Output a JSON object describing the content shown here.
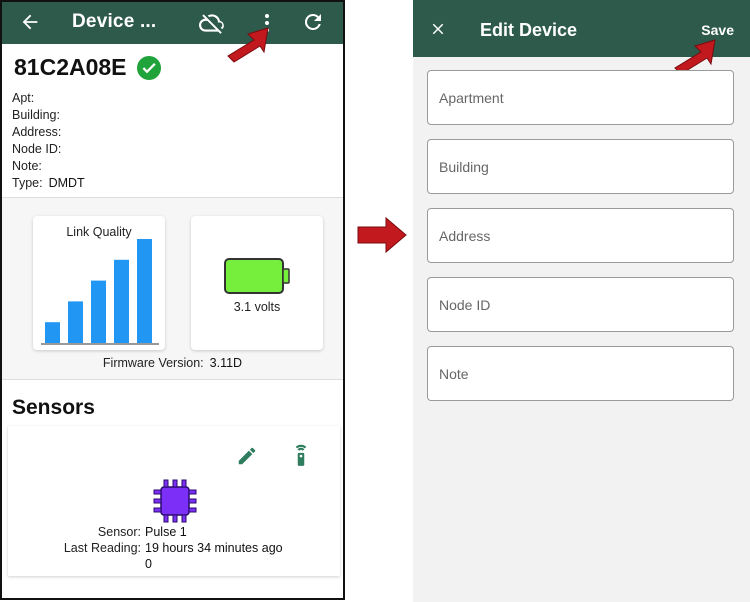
{
  "left_screen": {
    "appbar": {
      "title": "Device ...",
      "icons": [
        "arrow-back-icon",
        "cloud-off-icon",
        "more-vert-icon",
        "refresh-icon"
      ]
    },
    "device_id": "81C2A08E",
    "properties": [
      {
        "label": "Apt:",
        "value": ""
      },
      {
        "label": "Building:",
        "value": ""
      },
      {
        "label": "Address:",
        "value": ""
      },
      {
        "label": "Node ID:",
        "value": ""
      },
      {
        "label": "Note:",
        "value": ""
      },
      {
        "label": "Type:",
        "value": "DMDT"
      }
    ],
    "link_quality": {
      "title": "Link Quality",
      "bar_levels": [
        0.2,
        0.4,
        0.6,
        0.8,
        1.0
      ],
      "bar_color": "#2196f3"
    },
    "battery": {
      "label": "3.1 volts",
      "fill_color": "#76ee3c"
    },
    "firmware": {
      "label": "Firmware Version:",
      "value": "3.11D"
    },
    "sensors_title": "Sensors",
    "sensor": {
      "name_label": "Sensor:",
      "name_value": "Pulse 1",
      "reading_label": "Last Reading:",
      "reading_value": "19 hours 34 minutes ago",
      "reading_extra": "0",
      "chip_color": "#7b2ff7"
    }
  },
  "right_screen": {
    "appbar": {
      "title": "Edit Device",
      "save": "Save"
    },
    "fields": [
      {
        "placeholder": "Apartment",
        "value": ""
      },
      {
        "placeholder": "Building",
        "value": ""
      },
      {
        "placeholder": "Address",
        "value": ""
      },
      {
        "placeholder": "Node ID",
        "value": ""
      },
      {
        "placeholder": "Note",
        "value": ""
      }
    ]
  },
  "colors": {
    "appbar": "#2e5a4c",
    "arrow": "#c2191f",
    "check": "#1fa33a",
    "accent_icon": "#2e7d5e"
  }
}
